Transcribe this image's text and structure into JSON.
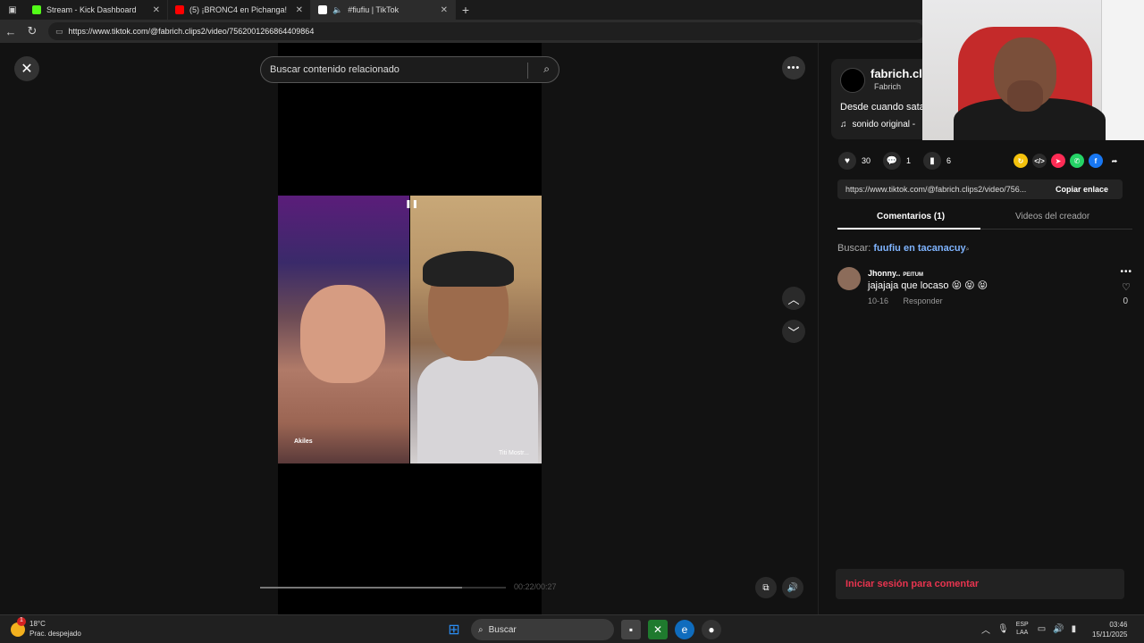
{
  "browser": {
    "tabs": [
      {
        "label": "Stream - Kick Dashboard",
        "color": "#53fc18"
      },
      {
        "label": "(5) ¡BRONC4 en Pichanga!",
        "color": "#ff0000"
      },
      {
        "label": "#fiufiu | TikTok",
        "color": "#ffffff"
      }
    ],
    "url": "https://www.tiktok.com/@fabrich.clips2/video/7562001266864409864"
  },
  "stage": {
    "search_placeholder": "Buscar contenido relacionado",
    "video_labels": {
      "left": "Akiles",
      "right": "Titi Mostr..."
    },
    "time": "00:22/00:27",
    "progress": 0.82
  },
  "creator": {
    "name": "fabrich.cli",
    "sub": "Fabrich",
    "desc": "Desde cuando sata",
    "sound": "sonido original -"
  },
  "actions": {
    "likes": "30",
    "comments": "1",
    "saves": "6"
  },
  "link": {
    "url": "https://www.tiktok.com/@fabrich.clips2/video/756...",
    "copy": "Copiar enlace"
  },
  "panel_tabs": [
    "Comentarios (1)",
    "Videos del creador"
  ],
  "buscar": {
    "label": "Buscar:",
    "query": "fuufiu en tacanacuy"
  },
  "comment": {
    "user": "Jhonny..",
    "tag": "PEITUM",
    "text": "jajajaja que locaso 😝 😝 😝",
    "date": "10-16",
    "reply": "Responder",
    "likes": "0"
  },
  "login": "Iniciar sesión para comentar",
  "taskbar": {
    "temp": "18°C",
    "weather": "Prac. despejado",
    "search": "Buscar",
    "lang": "ESP",
    "lang2": "LAA",
    "time": "03:46",
    "date": "15/11/2025"
  }
}
